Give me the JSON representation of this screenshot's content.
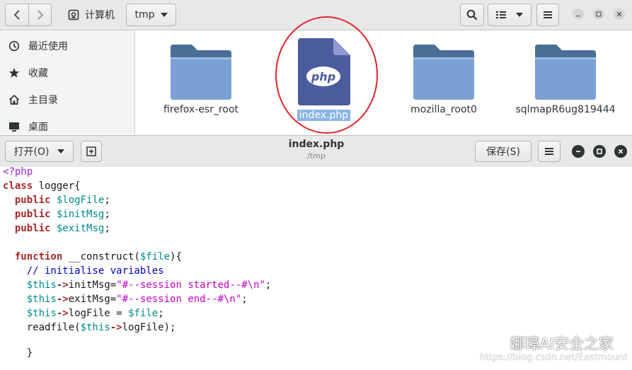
{
  "file_manager": {
    "nav": {
      "back_icon": "chevron-left",
      "forward_icon": "chevron-right"
    },
    "breadcrumb": {
      "home_label": "计算机",
      "current_label": "tmp"
    },
    "sidebar": [
      {
        "icon": "clock-icon",
        "label": "最近使用"
      },
      {
        "icon": "star-icon",
        "label": "收藏"
      },
      {
        "icon": "home-icon",
        "label": "主目录"
      },
      {
        "icon": "desktop-icon",
        "label": "桌面"
      }
    ],
    "files": [
      {
        "name": "firefox-esr_root",
        "type": "folder",
        "selected": false
      },
      {
        "name": "index.php",
        "type": "php",
        "selected": true,
        "badge": "php"
      },
      {
        "name": "mozilla_root0",
        "type": "folder",
        "selected": false
      },
      {
        "name": "sqlmapR6ug819444",
        "type": "folder",
        "selected": false
      }
    ]
  },
  "editor": {
    "open_label": "打开(O)",
    "title": "index.php",
    "path": "/tmp",
    "save_label": "保存(S)"
  },
  "watermark": {
    "brand": "娜璋AI安全之家",
    "url": "https://blog.csdn.net/Eastmount"
  },
  "colors": {
    "annotation_circle": "#e0262b",
    "selection": "#89b4e8",
    "folder": "#7aa0d4",
    "php_file": "#4b5c9e"
  }
}
